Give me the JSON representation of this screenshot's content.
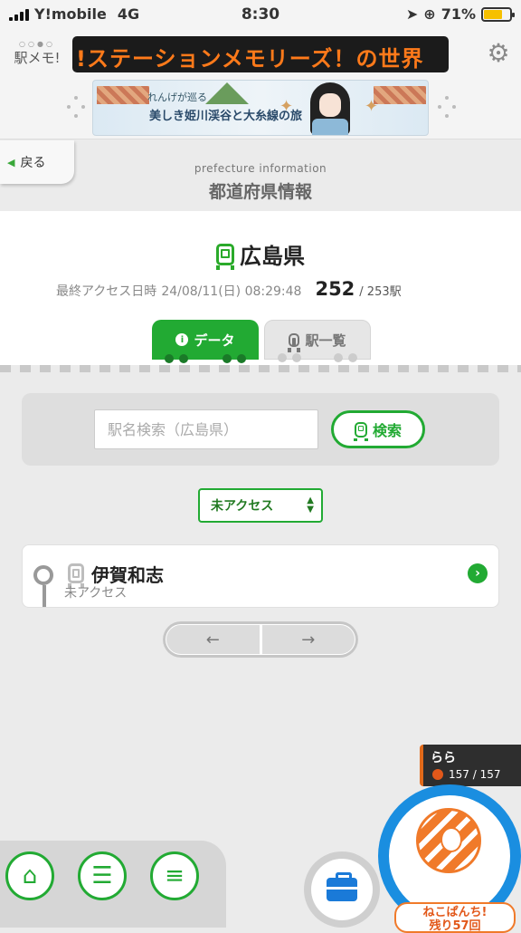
{
  "status_bar": {
    "carrier": "Y!mobile",
    "network": "4G",
    "time": "8:30",
    "battery": "71%"
  },
  "header": {
    "logo_text": "駅メモ!",
    "ticker_text": "!ステーションメモリーズ！の世界",
    "banner": {
      "line1": "れんげが巡る",
      "line2": "美しき姫川渓谷と大糸線の旅"
    }
  },
  "nav": {
    "back_label": "戻る",
    "title_en": "prefecture information",
    "title_jp": "都道府県情報"
  },
  "prefecture": {
    "name": "広島県",
    "last_access_label": "最終アクセス日時",
    "last_access_time": "24/08/11(日) 08:29:48",
    "accessed_count": "252",
    "total": "/ 253駅"
  },
  "tabs": {
    "data_label": "データ",
    "station_list_label": "駅一覧"
  },
  "search": {
    "placeholder": "駅名検索（広島県）",
    "button_label": "検索"
  },
  "filter": {
    "selected": "未アクセス"
  },
  "stations": [
    {
      "name": "伊賀和志",
      "status": "未アクセス"
    }
  ],
  "pager": {
    "prev": "←",
    "next": "→"
  },
  "player": {
    "name": "らら",
    "hp": "157 / 157"
  },
  "neko": {
    "line1": "ねこぱんち!",
    "line2": "残り57回"
  },
  "colors": {
    "accent_green": "#22aa33",
    "neko_blue": "#1a8ee0",
    "neko_orange": "#f07a2a"
  }
}
